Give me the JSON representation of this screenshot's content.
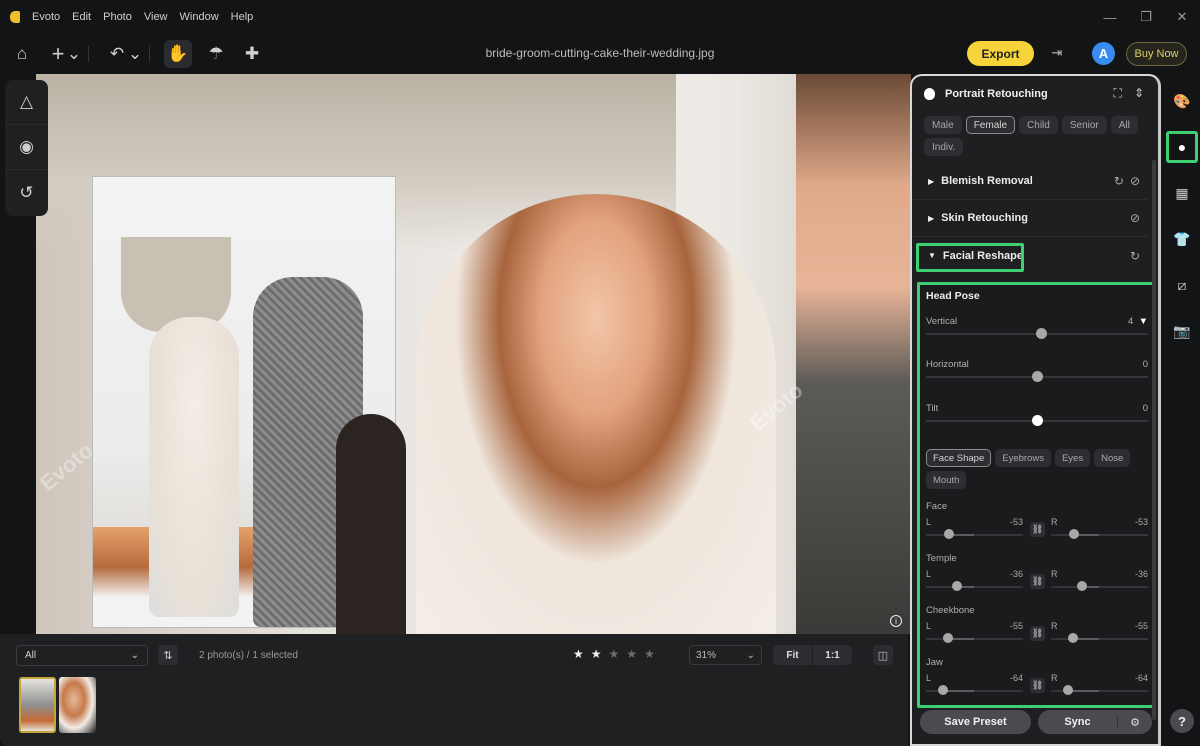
{
  "app": {
    "name": "Evoto",
    "menu": [
      "Evoto",
      "Edit",
      "Photo",
      "View",
      "Window",
      "Help"
    ],
    "window_controls": {
      "minimize": "—",
      "restore": "❐",
      "close": "✕"
    }
  },
  "toolbar": {
    "filename": "bride-groom-cutting-cake-their-wedding.jpg",
    "export_label": "Export",
    "avatar_letter": "A",
    "buy_label": "Buy Now",
    "icons": {
      "home": "⌂",
      "add": "+",
      "dropdown": "⌄",
      "undo": "↶",
      "hand": "✋",
      "brush": "☂",
      "bandage": "✚",
      "sidebar": "⇥"
    }
  },
  "left_tools": {
    "icons": [
      "△",
      "◉",
      "↺"
    ]
  },
  "canvas": {
    "watermark": "Evoto",
    "info_icon": "i"
  },
  "bottom": {
    "filter": {
      "value": "All",
      "chevron": "⌄"
    },
    "sort_icon": "⇅",
    "count": "2 photo(s) / 1 selected",
    "rating": {
      "value": 2,
      "max": 5,
      "star": "★"
    },
    "zoom": {
      "value": "31%",
      "chevron": "⌄"
    },
    "fit_label": "Fit",
    "one_to_one_label": "1:1",
    "compare_icon": "◫"
  },
  "panel": {
    "title": "Portrait Retouching",
    "header_icons": [
      "⛶",
      "⇕"
    ],
    "chips": [
      {
        "label": "Male",
        "selected": false
      },
      {
        "label": "Female",
        "selected": true
      },
      {
        "label": "Child",
        "selected": false
      },
      {
        "label": "Senior",
        "selected": false
      },
      {
        "label": "All",
        "selected": false
      },
      {
        "label": "Indiv.",
        "selected": false
      }
    ],
    "sections": [
      {
        "label": "Blemish Removal",
        "expanded": false,
        "icons": [
          "↻",
          "⊘"
        ]
      },
      {
        "label": "Skin Retouching",
        "expanded": false,
        "icons": [
          "⊘"
        ]
      },
      {
        "label": "Facial Reshape",
        "expanded": true,
        "icons": [
          "↻"
        ]
      }
    ],
    "arrow_collapsed": "▶",
    "arrow_expanded": "▼",
    "head_pose": {
      "title": "Head Pose",
      "sliders": [
        {
          "label": "Vertical",
          "value": "4",
          "pos": 0.52,
          "has_dropdown": true,
          "dropdown": "▼"
        },
        {
          "label": "Horizontal",
          "value": "0",
          "pos": 0.5
        },
        {
          "label": "Tilt",
          "value": "0",
          "pos": 0.5
        }
      ]
    },
    "tabs": [
      {
        "label": "Face Shape",
        "selected": true
      },
      {
        "label": "Eyebrows",
        "selected": false
      },
      {
        "label": "Eyes",
        "selected": false
      },
      {
        "label": "Nose",
        "selected": false
      },
      {
        "label": "Mouth",
        "selected": false
      }
    ],
    "pairs": [
      {
        "name": "Face",
        "left": "-53",
        "right": "-53",
        "l": -53,
        "r": -53
      },
      {
        "name": "Temple",
        "left": "-36",
        "right": "-36",
        "l": -36,
        "r": -36
      },
      {
        "name": "Cheekbone",
        "left": "-55",
        "right": "-55",
        "l": -55,
        "r": -55
      },
      {
        "name": "Jaw",
        "left": "-64",
        "right": "-64",
        "l": -64,
        "r": -64
      }
    ],
    "side_l": "L",
    "side_r": "R",
    "link_icon": "⛓",
    "save_preset_label": "Save Preset",
    "sync_label": "Sync",
    "sync_gear": "⚙"
  },
  "right_rail": {
    "icons": [
      {
        "name": "palette-icon",
        "glyph": "🎨",
        "selected": false
      },
      {
        "name": "portrait-icon",
        "glyph": "●",
        "selected": true
      },
      {
        "name": "background-icon",
        "glyph": "▦",
        "selected": false
      },
      {
        "name": "clothing-icon",
        "glyph": "👕",
        "selected": false
      },
      {
        "name": "crop-icon",
        "glyph": "⧄",
        "selected": false
      },
      {
        "name": "camera-icon",
        "glyph": "📷",
        "selected": false
      }
    ],
    "help": "?"
  },
  "accent": {
    "export": "#f6d43a",
    "highlight": "#3ecf72",
    "avatar": "#3a8bf0"
  }
}
